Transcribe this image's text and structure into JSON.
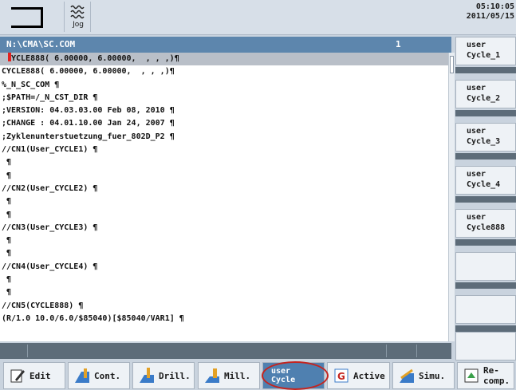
{
  "status": {
    "mode_label": "Jog",
    "time": "05:10:05",
    "date": "2011/05/15"
  },
  "editor": {
    "file_path": "N:\\CMA\\SC.COM",
    "window_number": "1",
    "lines": [
      "CYCLE888( 6.00000, 6.00000,  , , ,)¶",
      "CYCLE888( 6.00000, 6.00000,  , , ,)¶",
      "%_N_SC_COM ¶",
      ";$PATH=/_N_CST_DIR ¶",
      ";VERSION: 04.03.03.00 Feb 08, 2010 ¶",
      ";CHANGE : 04.01.10.00 Jan 24, 2007 ¶",
      ";Zyklenunterstuetzung_fuer_802D_P2 ¶",
      "//CN1(User_CYCLE1) ¶",
      " ¶",
      " ¶",
      "//CN2(User_CYCLE2) ¶",
      " ¶",
      " ¶",
      "//CN3(User_CYCLE3) ¶",
      " ¶",
      " ¶",
      "//CN4(User_CYCLE4) ¶",
      " ¶",
      " ¶",
      "//CN5(CYCLE888) ¶",
      "(R/1.0 10.0/6.0/$85040)[$85040/VAR1] ¶"
    ]
  },
  "vertical_softkeys": [
    "user\nCycle_1",
    "user\nCycle_2",
    "user\nCycle_3",
    "user\nCycle_4",
    "user\nCycle888",
    "",
    "",
    ""
  ],
  "horizontal_softkeys": [
    {
      "label": "Edit",
      "icon": "edit-icon"
    },
    {
      "label": "Cont.",
      "icon": "contour-icon"
    },
    {
      "label": "Drill.",
      "icon": "drill-icon"
    },
    {
      "label": "Mill.",
      "icon": "mill-icon"
    },
    {
      "label": "user\nCycle",
      "icon": ""
    },
    {
      "label": "Active",
      "icon": "program-icon"
    },
    {
      "label": "Simu.",
      "icon": "simulation-icon"
    },
    {
      "label": "Re-\ncomp.",
      "icon": "recompile-icon"
    }
  ],
  "colors": {
    "header": "#5d86ad",
    "selected_line": "#b9bfc8",
    "cursor": "#e3211e",
    "active_softkey": "#4f80b0",
    "highlight_ring": "#c4241f"
  }
}
